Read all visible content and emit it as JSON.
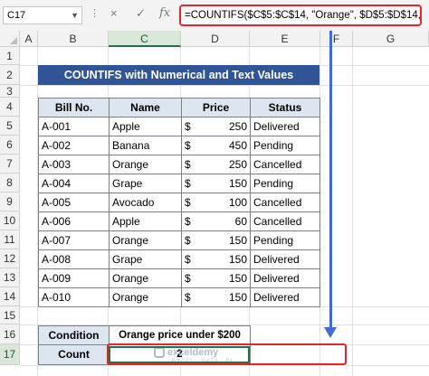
{
  "formula_bar": {
    "name_box": "C17",
    "dots": "⋮",
    "cancel_icon": "×",
    "enter_icon": "✓",
    "fx_label": "fx",
    "formula": "=COUNTIFS($C$5:$C$14, \"Orange\", $D$5:$D$14,\"<=200\")"
  },
  "columns": [
    "A",
    "B",
    "C",
    "D",
    "E",
    "F",
    "G"
  ],
  "rows": [
    "1",
    "2",
    "3",
    "4",
    "5",
    "6",
    "7",
    "8",
    "9",
    "10",
    "11",
    "12",
    "13",
    "14",
    "15",
    "16",
    "17"
  ],
  "title": "COUNTIFS with Numerical and Text Values",
  "table": {
    "headers": [
      "Bill No.",
      "Name",
      "Price",
      "Status"
    ],
    "rows": [
      {
        "bill": "A-001",
        "name": "Apple",
        "currency": "$",
        "price": "250",
        "status": "Delivered"
      },
      {
        "bill": "A-002",
        "name": "Banana",
        "currency": "$",
        "price": "450",
        "status": "Pending"
      },
      {
        "bill": "A-003",
        "name": "Orange",
        "currency": "$",
        "price": "250",
        "status": "Cancelled"
      },
      {
        "bill": "A-004",
        "name": "Grape",
        "currency": "$",
        "price": "150",
        "status": "Pending"
      },
      {
        "bill": "A-005",
        "name": "Avocado",
        "currency": "$",
        "price": "100",
        "status": "Cancelled"
      },
      {
        "bill": "A-006",
        "name": "Apple",
        "currency": "$",
        "price": "60",
        "status": "Cancelled"
      },
      {
        "bill": "A-007",
        "name": "Orange",
        "currency": "$",
        "price": "150",
        "status": "Pending"
      },
      {
        "bill": "A-008",
        "name": "Grape",
        "currency": "$",
        "price": "150",
        "status": "Delivered"
      },
      {
        "bill": "A-009",
        "name": "Orange",
        "currency": "$",
        "price": "150",
        "status": "Delivered"
      },
      {
        "bill": "A-010",
        "name": "Orange",
        "currency": "$",
        "price": "150",
        "status": "Delivered"
      }
    ]
  },
  "condition": {
    "label": "Condition",
    "value": "Orange price under $200"
  },
  "count": {
    "label": "Count",
    "value": "2"
  },
  "watermark": {
    "brand": "exceldemy",
    "tagline": "EXCEL · DATA · BI"
  },
  "colors": {
    "title_bg": "#2f5597",
    "header_bg": "#dce6f1",
    "highlight_red": "#e8232a",
    "arrow_blue": "#3f6ad8",
    "excel_green": "#217346"
  }
}
